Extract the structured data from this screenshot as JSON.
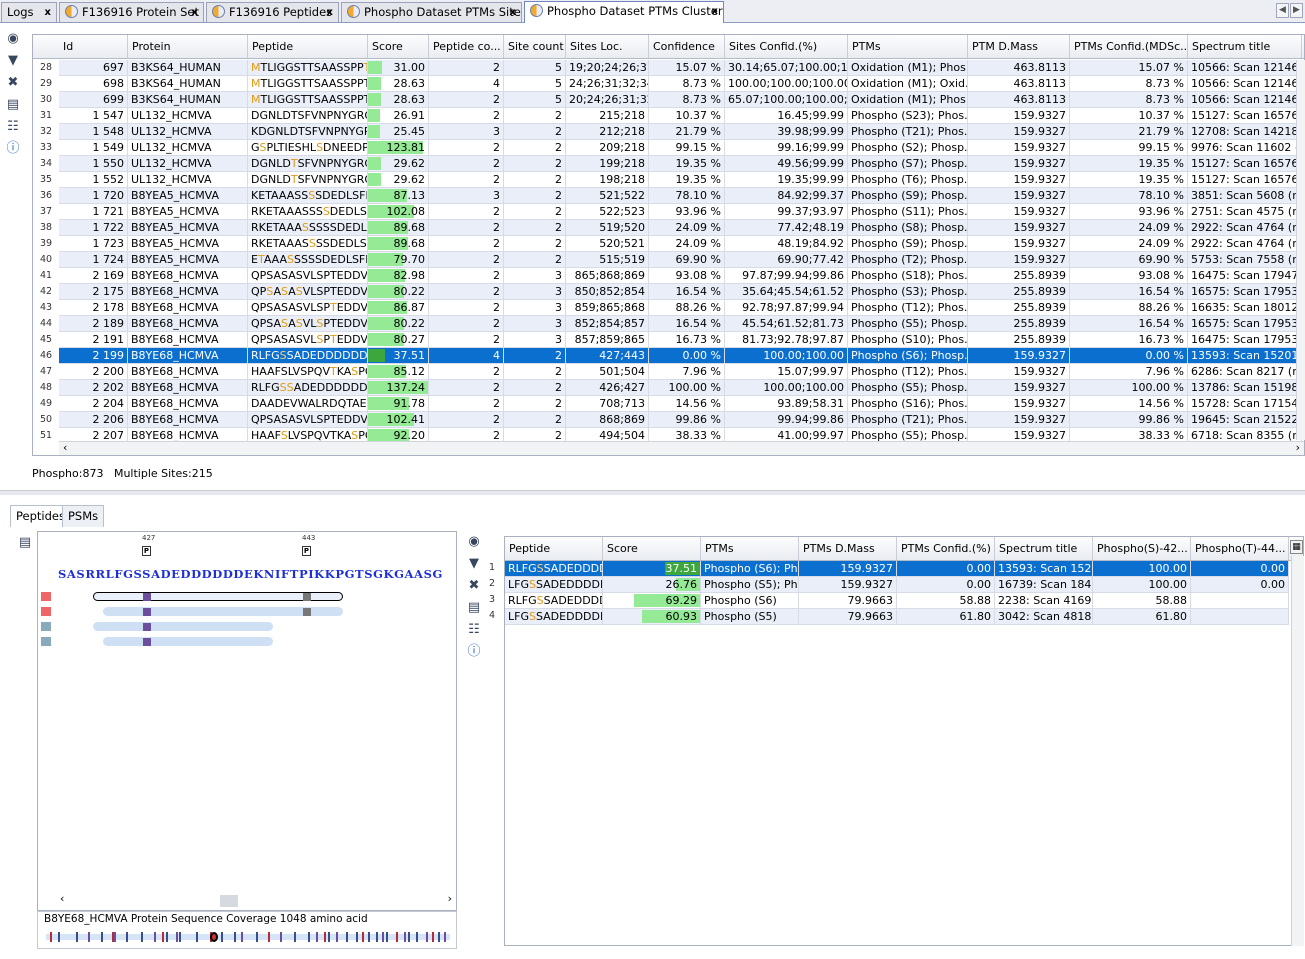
{
  "tabs": [
    {
      "label": "Logs",
      "has_icon": false
    },
    {
      "label": "F136916 Protein Set",
      "has_icon": true
    },
    {
      "label": "F136916 Peptides",
      "has_icon": true
    },
    {
      "label": "Phospho Dataset PTMs Sites",
      "has_icon": true
    },
    {
      "label": "Phospho Dataset PTMs Clusters",
      "has_icon": true
    }
  ],
  "close_glyph": "x",
  "nav": {
    "left": "◀",
    "right": "▶"
  },
  "top_table": {
    "columns": [
      "Id",
      "Protein",
      "Peptide",
      "Score",
      "Peptide co...",
      "Site count",
      "Sites Loc.",
      "Confidence",
      "Sites Confid.(%)",
      "PTMs",
      "PTM D.Mass",
      "PTMs Confid.(MDSc...",
      "Spectrum title"
    ],
    "rows": [
      {
        "n": "28",
        "id": "697",
        "protein": "B3KS64_HUMAN",
        "peptide": [
          [
            "M",
            "h"
          ],
          [
            "TLIGGSTTSAASSPP",
            ""
          ],
          [
            "TT",
            "h"
          ],
          [
            "I",
            ""
          ]
        ],
        "score": "31.00",
        "sf": 0.23,
        "pc": "2",
        "sc": "5",
        "loc": "19;20;24;26;31",
        "conf": "15.07 %",
        "sconf": "30.14;65.07;100.00;1...",
        "ptms": "Oxidation (M1); Phos...",
        "mass": "463.8113",
        "pconf": "15.07 %",
        "spec": "10566: Scan 12146 (rt"
      },
      {
        "n": "29",
        "id": "698",
        "protein": "B3KS64_HUMAN",
        "peptide": [
          [
            "M",
            "h"
          ],
          [
            "TLIGGSTTSAASSPPTTIP",
            ""
          ]
        ],
        "score": "28.63",
        "sf": 0.21,
        "pc": "4",
        "sc": "5",
        "loc": "24;26;31;32;34",
        "conf": "8.73 %",
        "sconf": "100.00;100.00;100.00...",
        "ptms": "Oxidation (M1); Oxid...",
        "mass": "463.8113",
        "pconf": "8.73 %",
        "spec": "10566: Scan 12146 (rt"
      },
      {
        "n": "30",
        "id": "699",
        "protein": "B3KS64_HUMAN",
        "peptide": [
          [
            "M",
            "h"
          ],
          [
            "TLIGGSTTSAASSPPTTI",
            ""
          ]
        ],
        "score": "28.63",
        "sf": 0.21,
        "pc": "2",
        "sc": "5",
        "loc": "20;24;26;31;32",
        "conf": "8.73 %",
        "sconf": "65.07;100.00;100.00;...",
        "ptms": "Oxidation (M1); Phos...",
        "mass": "463.8113",
        "pconf": "8.73 %",
        "spec": "10566: Scan 12146 (rt"
      },
      {
        "n": "31",
        "id": "1 547",
        "protein": "UL132_HCMVA",
        "peptide": [
          [
            "DGNLDTSFVNPNYGRGSPL",
            ""
          ]
        ],
        "score": "26.91",
        "sf": 0.2,
        "pc": "2",
        "sc": "2",
        "loc": "215;218",
        "conf": "10.37 %",
        "sconf": "16.45;99.99",
        "ptms": "Phospho (S23); Phos...",
        "mass": "159.9327",
        "pconf": "10.37 %",
        "spec": "15127: Scan 16576 (rt"
      },
      {
        "n": "32",
        "id": "1 548",
        "protein": "UL132_HCMVA",
        "peptide": [
          [
            "KDGNLDTSFVNPNYGRGS",
            ""
          ]
        ],
        "score": "25.45",
        "sf": 0.19,
        "pc": "3",
        "sc": "2",
        "loc": "212;218",
        "conf": "21.79 %",
        "sconf": "39.98;99.99",
        "ptms": "Phospho (T21); Phos...",
        "mass": "159.9327",
        "pconf": "21.79 %",
        "spec": "12708: Scan 14218 (rt"
      },
      {
        "n": "33",
        "id": "1 549",
        "protein": "UL132_HCMVA",
        "peptide": [
          [
            "G",
            ""
          ],
          [
            "S",
            "h"
          ],
          [
            "PLTIESHL",
            ""
          ],
          [
            "S",
            "h"
          ],
          [
            "DNEEDPIR",
            ""
          ]
        ],
        "score": "123.81",
        "sf": 0.9,
        "pc": "2",
        "sc": "2",
        "loc": "209;218",
        "conf": "99.15 %",
        "sconf": "99.16;99.99",
        "ptms": "Phospho (S2); Phosp...",
        "mass": "159.9327",
        "pconf": "99.15 %",
        "spec": "9976: Scan 11602 (rt..."
      },
      {
        "n": "34",
        "id": "1 550",
        "protein": "UL132_HCMVA",
        "peptide": [
          [
            "DGNLD",
            ""
          ],
          [
            "T",
            "h"
          ],
          [
            "SFVNPNYGRGSP",
            ""
          ]
        ],
        "score": "29.62",
        "sf": 0.22,
        "pc": "2",
        "sc": "2",
        "loc": "199;218",
        "conf": "19.35 %",
        "sconf": "49.56;99.99",
        "ptms": "Phospho (S7); Phosp...",
        "mass": "159.9327",
        "pconf": "19.35 %",
        "spec": "15127: Scan 16576 (rt"
      },
      {
        "n": "35",
        "id": "1 552",
        "protein": "UL132_HCMVA",
        "peptide": [
          [
            "DGNLD",
            ""
          ],
          [
            "T",
            "h"
          ],
          [
            "SFVNPNYGRGSPL",
            ""
          ]
        ],
        "score": "29.62",
        "sf": 0.22,
        "pc": "2",
        "sc": "2",
        "loc": "198;218",
        "conf": "19.35 %",
        "sconf": "19.35;99.99",
        "ptms": "Phospho (T6); Phosp...",
        "mass": "159.9327",
        "pconf": "19.35 %",
        "spec": "15127: Scan 16576 (rt"
      },
      {
        "n": "36",
        "id": "1 720",
        "protein": "B8YEA5_HCMVA",
        "peptide": [
          [
            "KETAAASS",
            ""
          ],
          [
            "S",
            "h"
          ],
          [
            "SDEDLSFP",
            ""
          ]
        ],
        "score": "87.13",
        "sf": 0.64,
        "pc": "3",
        "sc": "2",
        "loc": "521;522",
        "conf": "78.10 %",
        "sconf": "84.92;99.37",
        "ptms": "Phospho (S9); Phosp...",
        "mass": "159.9327",
        "pconf": "78.10 %",
        "spec": "3851: Scan 5608 (rt=..."
      },
      {
        "n": "37",
        "id": "1 721",
        "protein": "B8YEA5_HCMVA",
        "peptide": [
          [
            "RKETAAASSS",
            ""
          ],
          [
            "S",
            "h"
          ],
          [
            "DEDLSF",
            ""
          ]
        ],
        "score": "102.08",
        "sf": 0.75,
        "pc": "2",
        "sc": "2",
        "loc": "522;523",
        "conf": "93.96 %",
        "sconf": "99.37;93.97",
        "ptms": "Phospho (S11); Phos...",
        "mass": "159.9327",
        "pconf": "93.96 %",
        "spec": "2751: Scan 4575 (rt=..."
      },
      {
        "n": "38",
        "id": "1 722",
        "protein": "B8YEA5_HCMVA",
        "peptide": [
          [
            "RKETAAA",
            ""
          ],
          [
            "S",
            "h"
          ],
          [
            "SSSSDEDLSF",
            ""
          ]
        ],
        "score": "89.68",
        "sf": 0.66,
        "pc": "2",
        "sc": "2",
        "loc": "519;520",
        "conf": "24.09 %",
        "sconf": "77.42;48.19",
        "ptms": "Phospho (S8); Phosp...",
        "mass": "159.9327",
        "pconf": "24.09 %",
        "spec": "2922: Scan 4764 (rt=..."
      },
      {
        "n": "39",
        "id": "1 723",
        "protein": "B8YEA5_HCMVA",
        "peptide": [
          [
            "RKETAAAS",
            ""
          ],
          [
            "S",
            "h"
          ],
          [
            "SSDEDLSF",
            ""
          ]
        ],
        "score": "89.68",
        "sf": 0.66,
        "pc": "2",
        "sc": "2",
        "loc": "520;521",
        "conf": "24.09 %",
        "sconf": "48.19;84.92",
        "ptms": "Phospho (S9); Phosp...",
        "mass": "159.9327",
        "pconf": "24.09 %",
        "spec": "2922: Scan 4764 (rt=..."
      },
      {
        "n": "40",
        "id": "1 724",
        "protein": "B8YEA5_HCMVA",
        "peptide": [
          [
            "E",
            ""
          ],
          [
            "T",
            "h"
          ],
          [
            "AAA",
            ""
          ],
          [
            "S",
            "h"
          ],
          [
            "SSSSDEDLSFPGE",
            ""
          ]
        ],
        "score": "79.70",
        "sf": 0.58,
        "pc": "2",
        "sc": "2",
        "loc": "515;519",
        "conf": "69.90 %",
        "sconf": "69.90;77.42",
        "ptms": "Phospho (T2); Phosp...",
        "mass": "159.9327",
        "pconf": "69.90 %",
        "spec": "5753: Scan 7558 (rt=..."
      },
      {
        "n": "41",
        "id": "2 169",
        "protein": "B8YE68_HCMVA",
        "peptide": [
          [
            "QPSASASVLSPTEDDVV",
            ""
          ],
          [
            "S",
            "h"
          ]
        ],
        "score": "82.98",
        "sf": 0.61,
        "pc": "2",
        "sc": "3",
        "loc": "865;868;869",
        "conf": "93.08 %",
        "sconf": "97.87;99.94;99.86",
        "ptms": "Phospho (S18); Phos...",
        "mass": "255.8939",
        "pconf": "93.08 %",
        "spec": "16475: Scan 17947 (r"
      },
      {
        "n": "42",
        "id": "2 175",
        "protein": "B8YE68_HCMVA",
        "peptide": [
          [
            "QP",
            ""
          ],
          [
            "S",
            "h"
          ],
          [
            "A",
            ""
          ],
          [
            "S",
            "h"
          ],
          [
            "A",
            ""
          ],
          [
            "S",
            "h"
          ],
          [
            "VLSPTEDDVVS",
            ""
          ]
        ],
        "score": "80.22",
        "sf": 0.59,
        "pc": "2",
        "sc": "3",
        "loc": "850;852;854",
        "conf": "16.54 %",
        "sconf": "35.64;45.54;61.52",
        "ptms": "Phospho (S3); Phosp...",
        "mass": "255.8939",
        "pconf": "16.54 %",
        "spec": "16575: Scan 17953 (r"
      },
      {
        "n": "43",
        "id": "2 178",
        "protein": "B8YE68_HCMVA",
        "peptide": [
          [
            "QPSASASVLSP",
            ""
          ],
          [
            "T",
            "h"
          ],
          [
            "EDDVV",
            ""
          ],
          [
            "S",
            "h"
          ]
        ],
        "score": "86.87",
        "sf": 0.64,
        "pc": "2",
        "sc": "3",
        "loc": "859;865;868",
        "conf": "88.26 %",
        "sconf": "92.78;97.87;99.94",
        "ptms": "Phospho (T12); Phos...",
        "mass": "255.8939",
        "pconf": "88.26 %",
        "spec": "16635: Scan 18012 (r"
      },
      {
        "n": "44",
        "id": "2 189",
        "protein": "B8YE68_HCMVA",
        "peptide": [
          [
            "QPSA",
            ""
          ],
          [
            "S",
            "h"
          ],
          [
            "A",
            ""
          ],
          [
            "S",
            "h"
          ],
          [
            "VL",
            ""
          ],
          [
            "S",
            "h"
          ],
          [
            "PTEDDVVS",
            ""
          ]
        ],
        "score": "80.22",
        "sf": 0.59,
        "pc": "2",
        "sc": "3",
        "loc": "852;854;857",
        "conf": "16.54 %",
        "sconf": "45.54;61.52;81.73",
        "ptms": "Phospho (S5); Phosp...",
        "mass": "255.8939",
        "pconf": "16.54 %",
        "spec": "16575: Scan 17953 (r"
      },
      {
        "n": "45",
        "id": "2 191",
        "protein": "B8YE68_HCMVA",
        "peptide": [
          [
            "QPSASASVL",
            ""
          ],
          [
            "S",
            "h"
          ],
          [
            "P",
            ""
          ],
          [
            "T",
            "h"
          ],
          [
            "EDDVVS",
            ""
          ]
        ],
        "score": "80.27",
        "sf": 0.59,
        "pc": "2",
        "sc": "3",
        "loc": "857;859;865",
        "conf": "16.73 %",
        "sconf": "81.73;92.78;97.87",
        "ptms": "Phospho (S10); Phos...",
        "mass": "255.8939",
        "pconf": "16.73 %",
        "spec": "16475: Scan 17953 (r"
      },
      {
        "n": "46",
        "id": "2 199",
        "protein": "B8YE68_HCMVA",
        "peptide": [
          [
            "RLFG",
            ""
          ],
          [
            "S",
            "h"
          ],
          [
            "SADEDDDDDDE",
            ""
          ]
        ],
        "score": "37.51",
        "sf": 0.28,
        "pc": "4",
        "sc": "2",
        "loc": "427;443",
        "conf": "0.00 %",
        "sconf": "100.00;100.00",
        "ptms": "Phospho (S6); Phosp...",
        "mass": "159.9327",
        "pconf": "0.00 %",
        "spec": "13593: Scan 15201 (r",
        "selected": true
      },
      {
        "n": "47",
        "id": "2 200",
        "protein": "B8YE68_HCMVA",
        "peptide": [
          [
            "HAAFSLVSPQV",
            ""
          ],
          [
            "T",
            "h"
          ],
          [
            "KA",
            ""
          ],
          [
            "S",
            "h"
          ],
          [
            "PGR",
            ""
          ]
        ],
        "score": "85.12",
        "sf": 0.62,
        "pc": "2",
        "sc": "2",
        "loc": "501;504",
        "conf": "7.96 %",
        "sconf": "15.07;99.97",
        "ptms": "Phospho (T12); Phos...",
        "mass": "159.9327",
        "pconf": "7.96 %",
        "spec": "6286: Scan 8217 (rt=..."
      },
      {
        "n": "48",
        "id": "2 202",
        "protein": "B8YE68_HCMVA",
        "peptide": [
          [
            "RLFG",
            ""
          ],
          [
            "SS",
            "h"
          ],
          [
            "ADEDDDDDDEK",
            ""
          ]
        ],
        "score": "137.24",
        "sf": 1.0,
        "pc": "2",
        "sc": "2",
        "loc": "426;427",
        "conf": "100.00 %",
        "sconf": "100.00;100.00",
        "ptms": "Phospho (S5); Phosp...",
        "mass": "159.9327",
        "pconf": "100.00 %",
        "spec": "13786: Scan 15198 (r"
      },
      {
        "n": "49",
        "id": "2 204",
        "protein": "B8YE68_HCMVA",
        "peptide": [
          [
            "DAADEVWALRDQTAE",
            ""
          ],
          [
            "S",
            "h"
          ],
          [
            "PV",
            ""
          ]
        ],
        "score": "91.78",
        "sf": 0.67,
        "pc": "2",
        "sc": "2",
        "loc": "708;713",
        "conf": "14.56 %",
        "sconf": "93.89;58.31",
        "ptms": "Phospho (S16); Phos...",
        "mass": "159.9327",
        "pconf": "14.56 %",
        "spec": "15728: Scan 17154 (r"
      },
      {
        "n": "50",
        "id": "2 206",
        "protein": "B8YE68_HCMVA",
        "peptide": [
          [
            "QPSASASVLSPTEDDVVSP",
            ""
          ]
        ],
        "score": "102.41",
        "sf": 0.75,
        "pc": "2",
        "sc": "2",
        "loc": "868;869",
        "conf": "99.86 %",
        "sconf": "99.94;99.86",
        "ptms": "Phospho (T21); Phos...",
        "mass": "159.9327",
        "pconf": "99.86 %",
        "spec": "19645: Scan 21522 (r"
      },
      {
        "n": "51",
        "id": "2 207",
        "protein": "B8YE68_HCMVA",
        "peptide": [
          [
            "HAAF",
            ""
          ],
          [
            "S",
            "h"
          ],
          [
            "LVSPQVTKA",
            ""
          ],
          [
            "S",
            "h"
          ],
          [
            "PGR",
            ""
          ]
        ],
        "score": "92.20",
        "sf": 0.67,
        "pc": "2",
        "sc": "2",
        "loc": "494;504",
        "conf": "38.33 %",
        "sconf": "41.00;99.97",
        "ptms": "Phospho (S5); Phosp...",
        "mass": "159.9327",
        "pconf": "38.33 %",
        "spec": "6718: Scan 8355 (rt=..."
      }
    ]
  },
  "status": {
    "phospho": "Phospho:873",
    "multi": "Multiple Sites:215"
  },
  "lower_tabs": [
    "Peptides",
    "PSMs"
  ],
  "sequence": {
    "text": "SASRRLFGSSADEDDDDDDEKNIFTPIKKPGTSGKGAASG",
    "marks": [
      {
        "label": "427",
        "glyph": "P"
      },
      {
        "label": "443",
        "glyph": "P"
      }
    ],
    "coverage_label": "B8YE68_HCMVA Protein Sequence Coverage 1048 amino acid"
  },
  "bottom_table": {
    "columns": [
      "Peptide",
      "Score",
      "PTMs",
      "PTMs D.Mass",
      "PTMs Confid.(%)",
      "Spectrum title",
      "Phospho(S)-42...",
      "Phospho(T)-44..."
    ],
    "rows": [
      {
        "n": "1",
        "peptide": [
          [
            "RLFG",
            ""
          ],
          [
            "S",
            "h"
          ],
          [
            "SADEDDDDDD",
            ""
          ]
        ],
        "score": "37.51",
        "sf": 0.37,
        "ptms": "Phospho (S6); Ph...",
        "mass": "159.9327",
        "pconf": "0.00",
        "spec": "13593: Scan 152...",
        "ps": "100.00",
        "pt": "0.00",
        "selected": true
      },
      {
        "n": "2",
        "peptide": [
          [
            "LFG",
            ""
          ],
          [
            "S",
            "h"
          ],
          [
            "SADEDDDDDD",
            ""
          ]
        ],
        "score": "26.76",
        "sf": 0.26,
        "ptms": "Phospho (S5); Ph...",
        "mass": "159.9327",
        "pconf": "0.00",
        "spec": "16739: Scan 184...",
        "ps": "100.00",
        "pt": "0.00"
      },
      {
        "n": "3",
        "peptide": [
          [
            "RLFG",
            ""
          ],
          [
            "S",
            "h"
          ],
          [
            "SADEDDDDD",
            ""
          ]
        ],
        "score": "69.29",
        "sf": 0.68,
        "ptms": "Phospho (S6)",
        "mass": "79.9663",
        "pconf": "58.88",
        "spec": "2238: Scan 4169...",
        "ps": "58.88",
        "pt": ""
      },
      {
        "n": "4",
        "peptide": [
          [
            "LFG",
            ""
          ],
          [
            "S",
            "h"
          ],
          [
            "SADEDDDDDD",
            ""
          ]
        ],
        "score": "60.93",
        "sf": 0.6,
        "ptms": "Phospho (S5)",
        "mass": "79.9663",
        "pconf": "61.80",
        "spec": "3042: Scan 4818...",
        "ps": "61.80",
        "pt": ""
      }
    ]
  },
  "colors": {
    "selection": "#0b6fd0",
    "score_bar": "#95ea95",
    "modification": "#e09a14",
    "sequence": "#1d2fd6",
    "ptm_site": "#6b4f9e"
  },
  "icons": [
    "binoculars-icon",
    "filter-warning-icon",
    "tools-icon",
    "export-icon",
    "add-columns-icon",
    "info-icon"
  ]
}
